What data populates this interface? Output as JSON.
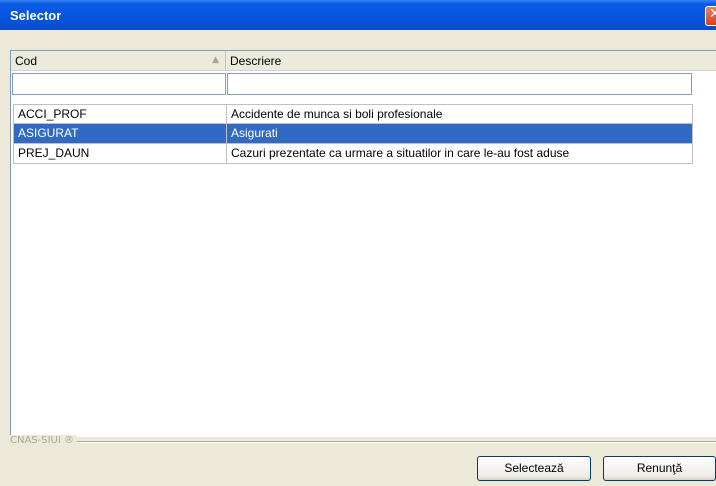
{
  "window": {
    "title": "Selector",
    "close_glyph": "✕"
  },
  "grid": {
    "columns": [
      {
        "label": "Cod",
        "sort_icon": "▲"
      },
      {
        "label": "Descriere"
      }
    ],
    "filters": [
      "",
      ""
    ],
    "rows": [
      {
        "cod": "ACCI_PROF",
        "descriere": "Accidente de munca si boli profesionale",
        "selected": false
      },
      {
        "cod": "ASIGURAT",
        "descriere": "Asigurati",
        "selected": true
      },
      {
        "cod": "PREJ_DAUN",
        "descriere": "Cazuri prezentate ca urmare a situatilor in care le-au fost aduse",
        "selected": false
      }
    ],
    "colors": {
      "selection": "#316ac5",
      "header": "#ebeadb"
    }
  },
  "footer": {
    "group_label": "CNAS-SIUI ®",
    "select_button": "Selectează",
    "cancel_button": "Renunţă"
  },
  "icons": {
    "sort": "sort-ascending-icon",
    "close": "close-icon"
  }
}
